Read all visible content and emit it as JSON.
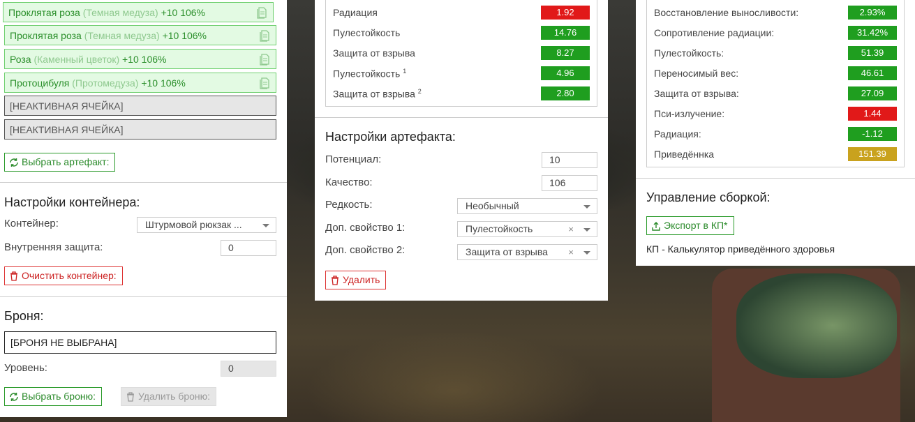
{
  "colors": {
    "good": "#1f9e1f",
    "bad": "#e11919",
    "neutral": "#c9a21e",
    "accent": "#2a9a2a"
  },
  "cells": [
    {
      "name": "Проклятая роза",
      "sub": "(Темная медуза)",
      "bonus": "+10 106%"
    },
    {
      "name": "Проклятая роза",
      "sub": "(Темная медуза)",
      "bonus": "+10 106%"
    },
    {
      "name": "Роза",
      "sub": "(Каменный цветок)",
      "bonus": "+10 106%"
    },
    {
      "name": "Протоцибуля",
      "sub": "(Протомедуза)",
      "bonus": "+10 106%"
    }
  ],
  "inactive_cells": [
    "[НЕАКТИВНАЯ ЯЧЕЙКА]",
    "[НЕАКТИВНАЯ ЯЧЕЙКА]"
  ],
  "left": {
    "select_artifact": "Выбрать артефакт:",
    "container_heading": "Настройки контейнера:",
    "container_label": "Контейнер:",
    "container_value": "Штурмовой рюкзак ...",
    "inner_protection_label": "Внутренняя защита:",
    "inner_protection_value": "0",
    "clear_container": "Очистить контейнер:",
    "armor_heading": "Броня:",
    "armor_value": "[БРОНЯ НЕ ВЫБРАНА]",
    "level_label": "Уровень:",
    "level_value": "0",
    "select_armor": "Выбрать броню:",
    "delete_armor": "Удалить броню:"
  },
  "artifact_stats": [
    {
      "label": "Радиация",
      "sup": "",
      "value": "1.92",
      "status": "bad"
    },
    {
      "label": "Пулестойкость",
      "sup": "",
      "value": "14.76",
      "status": "good"
    },
    {
      "label": "Защита от взрыва",
      "sup": "",
      "value": "8.27",
      "status": "good"
    },
    {
      "label": "Пулестойкость",
      "sup": "1",
      "value": "4.96",
      "status": "good"
    },
    {
      "label": "Защита от взрыва",
      "sup": "2",
      "value": "2.80",
      "status": "good"
    }
  ],
  "artifact_settings": {
    "heading": "Настройки артефакта:",
    "potential_label": "Потенциал:",
    "potential_value": "10",
    "quality_label": "Качество:",
    "quality_value": "106",
    "rarity_label": "Редкость:",
    "rarity_value": "Необычный",
    "prop1_label": "Доп. свойство 1:",
    "prop1_value": "Пулестойкость",
    "prop2_label": "Доп. свойство 2:",
    "prop2_value": "Защита от взрыва",
    "clear_mark": "×",
    "delete": "Удалить"
  },
  "build_stats": [
    {
      "label": "Восстановление выносливости:",
      "value": "2.93%",
      "status": "good"
    },
    {
      "label": "Сопротивление радиации:",
      "value": "31.42%",
      "status": "good"
    },
    {
      "label": "Пулестойкость:",
      "value": "51.39",
      "status": "good"
    },
    {
      "label": "Переносимый вес:",
      "value": "46.61",
      "status": "good"
    },
    {
      "label": "Защита от взрыва:",
      "value": "27.09",
      "status": "good"
    },
    {
      "label": "Пси-излучение:",
      "value": "1.44",
      "status": "bad"
    },
    {
      "label": "Радиация:",
      "value": "-1.12",
      "status": "good"
    },
    {
      "label": "Приведённка",
      "value": "151.39",
      "status": "neutral"
    }
  ],
  "build": {
    "heading": "Управление сборкой:",
    "export": "Экспорт в КП*",
    "note": "КП - Калькулятор приведённого здоровья"
  }
}
